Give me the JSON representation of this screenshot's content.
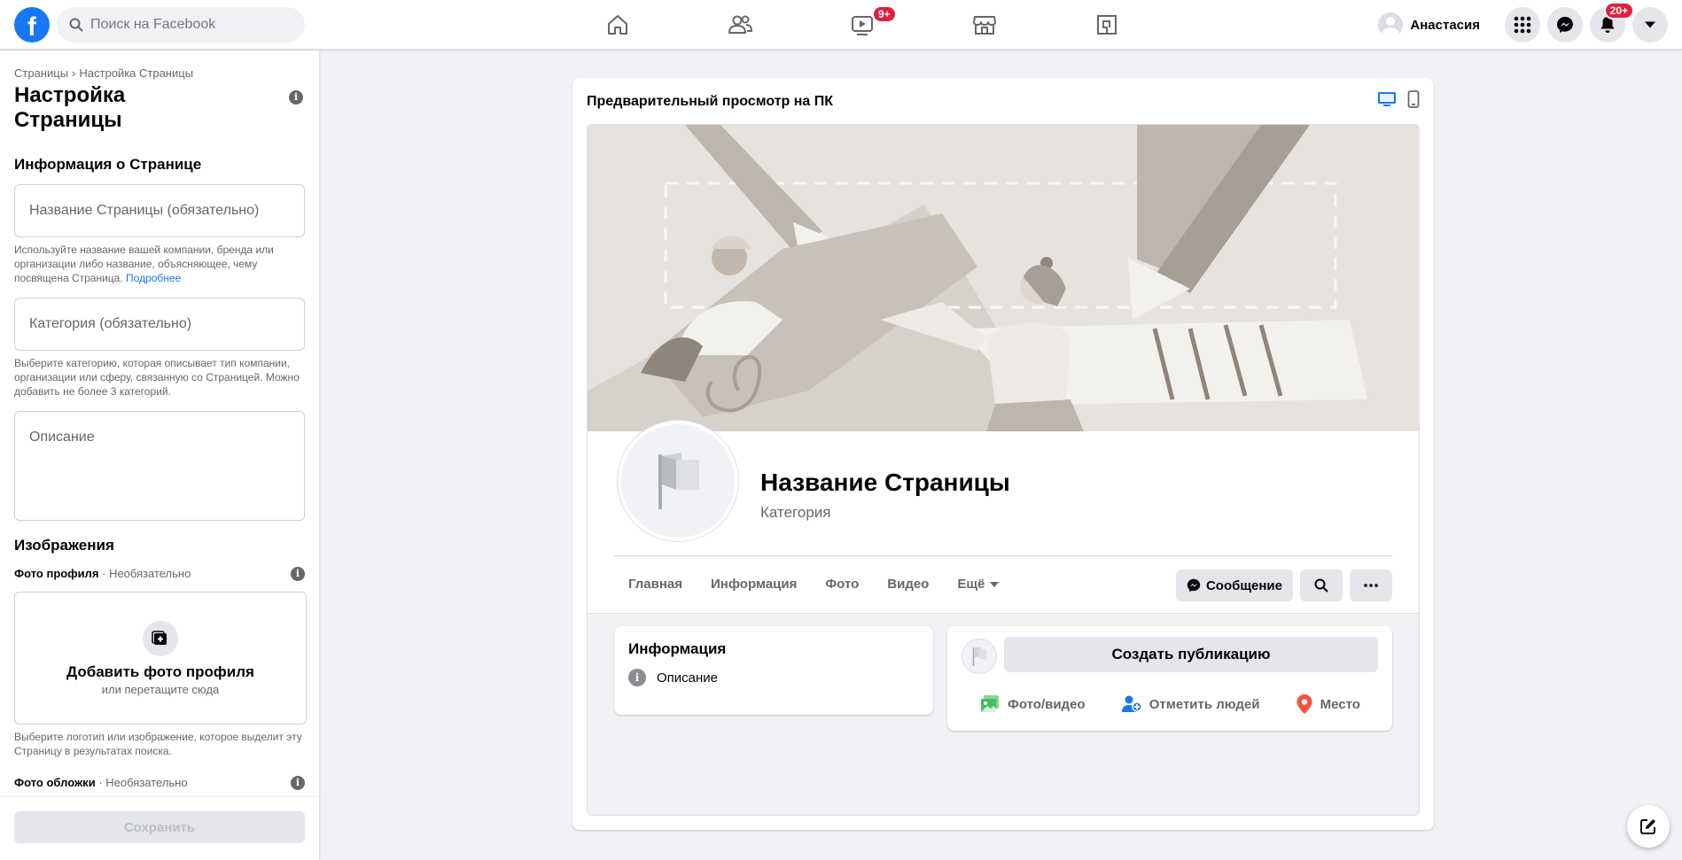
{
  "topbar": {
    "logo": "f",
    "search_placeholder": "Поиск на Facebook",
    "nav_items": [
      "home-icon",
      "friends-icon",
      "watch-icon",
      "marketplace-icon",
      "gaming-icon"
    ],
    "watch_badge": "9+",
    "user_name": "Анастасия",
    "notifications_badge": "20+"
  },
  "left": {
    "breadcrumb": [
      "Страницы",
      "Настройка Страницы"
    ],
    "title": "Настройка Страницы",
    "info_section": "Информация о Странице",
    "name_placeholder": "Название Страницы (обязательно)",
    "name_hint": "Используйте название вашей компании, бренда или организации либо название, объясняющее, чему посвящена Страница.",
    "name_hint_link": "Подробнее",
    "category_placeholder": "Категория (обязательно)",
    "category_hint": "Выберите категорию, которая описывает тип компании, организации или сферу, связанную со Страницей. Можно добавить не более 3 категорий.",
    "description_placeholder": "Описание",
    "images_section": "Изображения",
    "profile_photo_label": "Фото профиля",
    "optional": "· Необязательно",
    "add_profile_photo": "Добавить фото профиля",
    "drag_hint": "или перетащите сюда",
    "profile_photo_hint": "Выберите логотип или изображение, которое выделит эту Страницу в результатах поиска.",
    "cover_photo_label": "Фото обложки",
    "save_label": "Сохранить"
  },
  "preview": {
    "header": "Предварительный просмотр на ПК",
    "page_name": "Название Страницы",
    "category": "Категория",
    "tabs": [
      "Главная",
      "Информация",
      "Фото",
      "Видео",
      "Ещё"
    ],
    "message_button": "Сообщение",
    "info_card_title": "Информация",
    "info_card_item": "Описание",
    "create_post": "Создать публикацию",
    "actions": [
      "Фото/видео",
      "Отметить людей",
      "Место"
    ]
  },
  "colors": {
    "brand": "#1877f2",
    "badge": "#e41e3f",
    "background": "#f0f2f5"
  }
}
